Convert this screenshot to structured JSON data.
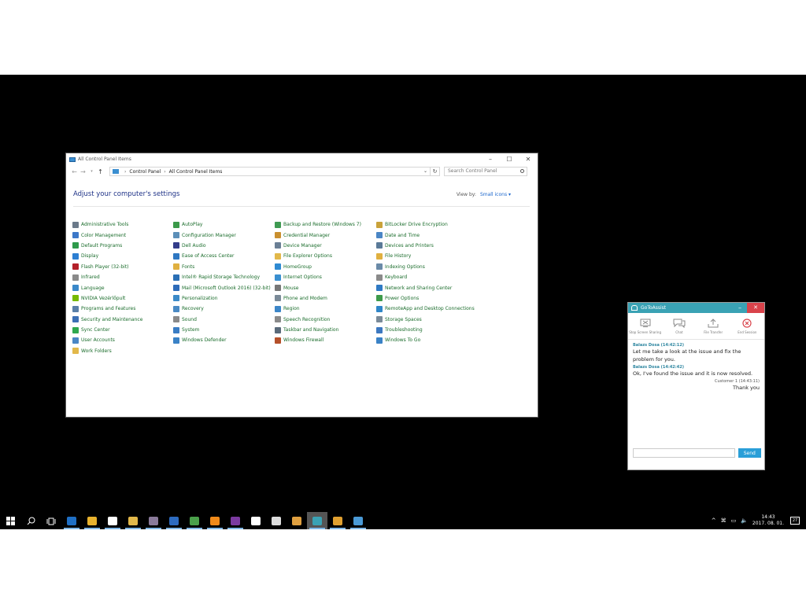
{
  "control_panel": {
    "window_title": "All Control Panel Items",
    "breadcrumb": [
      "Control Panel",
      "All Control Panel Items"
    ],
    "search_placeholder": "Search Control Panel",
    "heading": "Adjust your computer's settings",
    "view_by_label": "View by:",
    "view_by_value": "Small icons",
    "columns": [
      [
        {
          "label": "Administrative Tools",
          "color": "#6b7a8a"
        },
        {
          "label": "Color Management",
          "color": "#3c78c8"
        },
        {
          "label": "Default Programs",
          "color": "#2e9a4b"
        },
        {
          "label": "Display",
          "color": "#2d7fd2"
        },
        {
          "label": "Flash Player (32-bit)",
          "color": "#b3202a"
        },
        {
          "label": "Infrared",
          "color": "#8a8a8a"
        },
        {
          "label": "Language",
          "color": "#3a88c9"
        },
        {
          "label": "NVIDIA Vezérlőpult",
          "color": "#76b900"
        },
        {
          "label": "Programs and Features",
          "color": "#5a7fa8"
        },
        {
          "label": "Security and Maintenance",
          "color": "#3c6fb5"
        },
        {
          "label": "Sync Center",
          "color": "#2fa84f"
        },
        {
          "label": "User Accounts",
          "color": "#4a86c5"
        },
        {
          "label": "Work Folders",
          "color": "#e2b84a"
        }
      ],
      [
        {
          "label": "AutoPlay",
          "color": "#3b9a4a"
        },
        {
          "label": "Configuration Manager",
          "color": "#5c8fb8"
        },
        {
          "label": "Dell Audio",
          "color": "#333d8a"
        },
        {
          "label": "Ease of Access Center",
          "color": "#2f78c2"
        },
        {
          "label": "Fonts",
          "color": "#e0b040"
        },
        {
          "label": "Intel® Rapid Storage Technology",
          "color": "#2a6fb5"
        },
        {
          "label": "Mail (Microsoft Outlook 2016) (32-bit)",
          "color": "#2d6bb8"
        },
        {
          "label": "Personalization",
          "color": "#3c8ac8"
        },
        {
          "label": "Recovery",
          "color": "#4a8ac4"
        },
        {
          "label": "Sound",
          "color": "#8a8a8a"
        },
        {
          "label": "System",
          "color": "#3a7dc4"
        },
        {
          "label": "Windows Defender",
          "color": "#3a82c6"
        }
      ],
      [
        {
          "label": "Backup and Restore (Windows 7)",
          "color": "#3f9a52"
        },
        {
          "label": "Credential Manager",
          "color": "#c98f2f"
        },
        {
          "label": "Device Manager",
          "color": "#6a7f95"
        },
        {
          "label": "File Explorer Options",
          "color": "#e2b84a"
        },
        {
          "label": "HomeGroup",
          "color": "#2f8ad2"
        },
        {
          "label": "Internet Options",
          "color": "#3a8fd0"
        },
        {
          "label": "Mouse",
          "color": "#777777"
        },
        {
          "label": "Phone and Modem",
          "color": "#7a8a98"
        },
        {
          "label": "Region",
          "color": "#3c86c8"
        },
        {
          "label": "Speech Recognition",
          "color": "#8a8a8a"
        },
        {
          "label": "Taskbar and Navigation",
          "color": "#5a6a7a"
        },
        {
          "label": "Windows Firewall",
          "color": "#b5502a"
        }
      ],
      [
        {
          "label": "BitLocker Drive Encryption",
          "color": "#c9a23a"
        },
        {
          "label": "Date and Time",
          "color": "#4a86c5"
        },
        {
          "label": "Devices and Printers",
          "color": "#5a7a98"
        },
        {
          "label": "File History",
          "color": "#e0b040"
        },
        {
          "label": "Indexing Options",
          "color": "#6a8aa8"
        },
        {
          "label": "Keyboard",
          "color": "#8a8a8a"
        },
        {
          "label": "Network and Sharing Center",
          "color": "#2f7ac4"
        },
        {
          "label": "Power Options",
          "color": "#3d9a4a"
        },
        {
          "label": "RemoteApp and Desktop Connections",
          "color": "#2f86c8"
        },
        {
          "label": "Storage Spaces",
          "color": "#7a8a98"
        },
        {
          "label": "Troubleshooting",
          "color": "#3c78c0"
        },
        {
          "label": "Windows To Go",
          "color": "#3a82c6"
        }
      ]
    ]
  },
  "gotoassist": {
    "title": "GoToAssist",
    "tools": [
      {
        "label": "Stop Screen Sharing",
        "icon": "screen-share-icon"
      },
      {
        "label": "Chat",
        "icon": "chat-icon"
      },
      {
        "label": "File Transfer",
        "icon": "file-transfer-icon"
      },
      {
        "label": "End Session",
        "icon": "end-session-icon"
      }
    ],
    "messages": [
      {
        "sender": "Balazs Dosa (14:42:12)",
        "text": "Let me take a look at the issue and fix the problem for you.",
        "align": "left"
      },
      {
        "sender": "Balazs Dosa (14:42:42)",
        "text": "Ok, I've found the issue and it is now resolved.",
        "align": "left"
      },
      {
        "sender": "Customer 1 (14:43:11)",
        "text": "Thank you",
        "align": "right"
      }
    ],
    "send_label": "Send"
  },
  "taskbar": {
    "apps": [
      {
        "name": "start-icon",
        "color": "#ffffff"
      },
      {
        "name": "search-icon",
        "color": "#ffffff"
      },
      {
        "name": "task-view-icon",
        "color": "#ffffff"
      },
      {
        "name": "outlook-icon",
        "color": "#1f6fc4",
        "running": true
      },
      {
        "name": "chrome-icon",
        "color": "#e8b22e",
        "running": true
      },
      {
        "name": "app-icon",
        "color": "#ffffff",
        "running": true
      },
      {
        "name": "file-explorer-icon",
        "color": "#e2b84a",
        "running": true
      },
      {
        "name": "app-icon",
        "color": "#8a7a9a",
        "running": true
      },
      {
        "name": "save-icon",
        "color": "#2d6bc0",
        "running": true
      },
      {
        "name": "app-icon",
        "color": "#4aa04a",
        "running": true
      },
      {
        "name": "vlc-icon",
        "color": "#f08a1a",
        "running": true
      },
      {
        "name": "onenote-icon",
        "color": "#7b3aa0",
        "running": true
      },
      {
        "name": "document-icon",
        "color": "#ffffff"
      },
      {
        "name": "calculator-icon",
        "color": "#dddddd"
      },
      {
        "name": "app-icon",
        "color": "#e0a040"
      },
      {
        "name": "gotoassist-icon",
        "color": "#3aa2b4",
        "running": true,
        "active": true
      },
      {
        "name": "gotoassist-icon",
        "color": "#e0a030",
        "running": true
      },
      {
        "name": "mail-icon",
        "color": "#4a9ad6",
        "running": true
      }
    ],
    "time": "14:43",
    "date": "2017. 08. 01.",
    "notification_count": "27"
  }
}
